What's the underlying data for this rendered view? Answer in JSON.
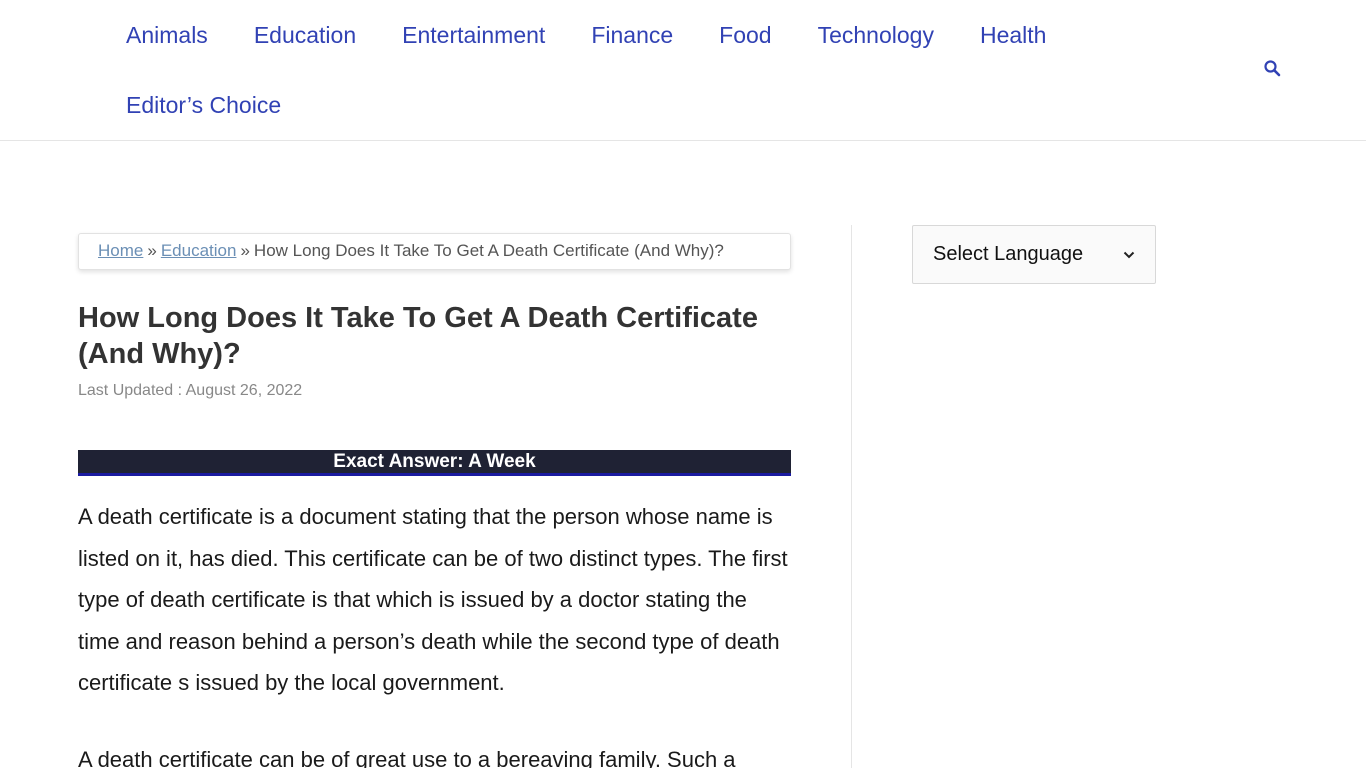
{
  "nav": {
    "row1": [
      "Animals",
      "Education",
      "Entertainment",
      "Finance",
      "Food",
      "Technology",
      "Health"
    ],
    "row2": [
      "Editor’s Choice"
    ]
  },
  "icons": {
    "search": "search-icon",
    "dropdown": "chevron-down-icon"
  },
  "colors": {
    "nav_link": "#3142b4",
    "answer_bg": "#1f2234",
    "answer_border": "#1b1ba0",
    "breadcrumb_link": "#6b8fb5"
  },
  "breadcrumb": {
    "home": "Home",
    "separator": "»",
    "category": "Education",
    "current": "How Long Does It Take To Get A Death Certificate (And Why)?"
  },
  "article": {
    "title": "How Long Does It Take To Get A Death Certificate (And Why)?",
    "updated": "Last Updated : August 26, 2022",
    "exact_answer": "Exact Answer: A Week",
    "paragraph1": "A death certificate is a document stating that the person whose name is listed on it, has died. This certificate can be of two distinct types. The first type of death certificate is that which is issued by a doctor stating the time and reason behind a person’s death while the second type of death certificate s issued by the local government.",
    "paragraph2": "A death certificate can be of great use to a bereaving family. Such a"
  },
  "sidebar": {
    "language_select": "Select Language"
  }
}
